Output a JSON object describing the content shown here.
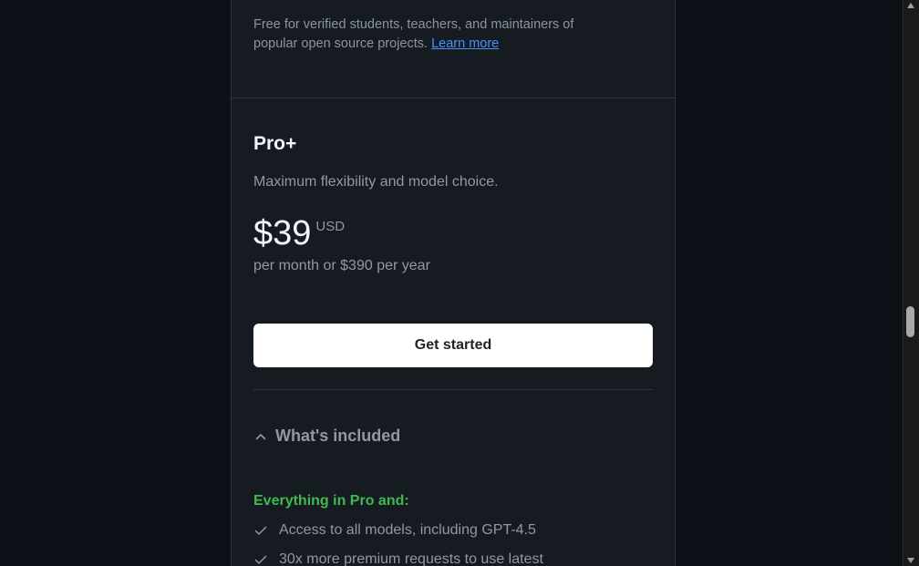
{
  "free_note": {
    "text": "Free for verified students, teachers, and maintainers of popular open source projects.",
    "link_label": "Learn more"
  },
  "plan": {
    "name": "Pro+",
    "description": "Maximum flexibility and model choice.",
    "price": "$39",
    "currency": "USD",
    "billing": "per month or $390 per year",
    "cta_label": "Get started"
  },
  "included": {
    "toggle_label": "What's included",
    "toggle_icon": "chevron-up-icon",
    "heading": "Everything in Pro and:",
    "features": [
      "Access to all models, including GPT-4.5",
      "30x more premium requests to use latest"
    ]
  },
  "colors": {
    "background": "#0d1117",
    "card": "#161b22",
    "border": "#30363d",
    "link": "#4493f8",
    "accent_green": "#3fb950",
    "muted_text": "#9198a1"
  }
}
